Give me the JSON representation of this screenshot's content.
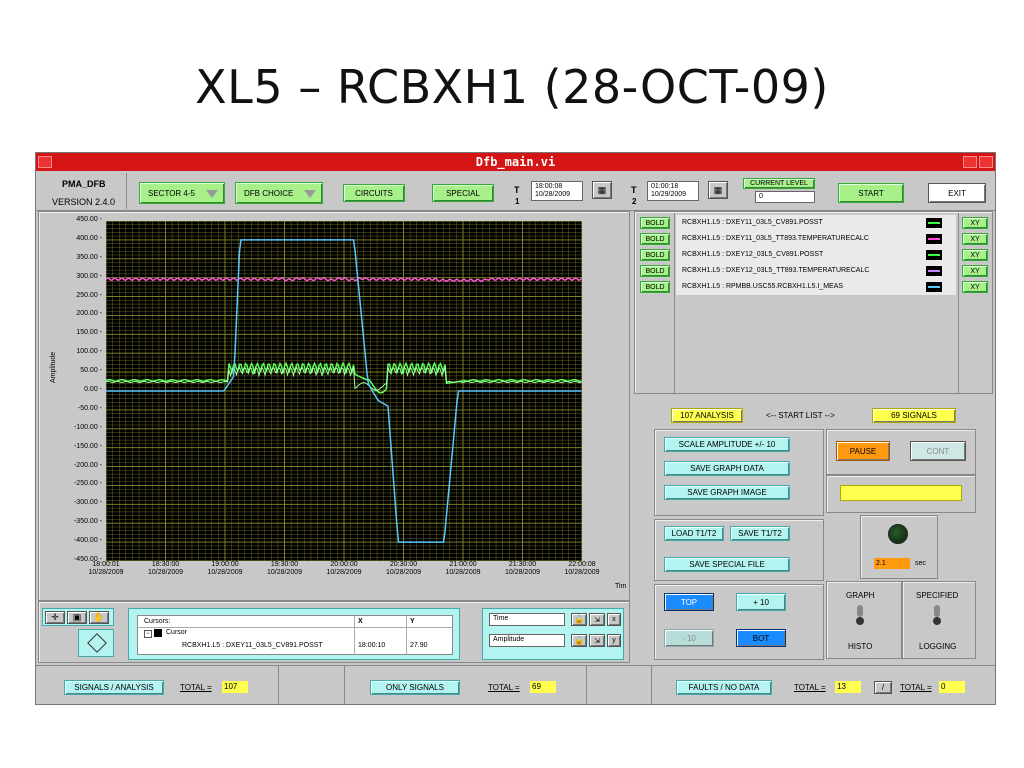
{
  "slide": {
    "title": "XL5 – RCBXH1 (28-OCT-09)"
  },
  "window": {
    "title": "Dfb_main.vi"
  },
  "toolbar": {
    "app_name": "PMA_DFB",
    "version": "VERSION 2.4.0",
    "sector": "SECTOR 4-5",
    "dfb_choice": "DFB CHOICE",
    "circuits": "CIRCUITS",
    "special": "SPECIAL",
    "t1_label": "T",
    "t1_sub": "1",
    "t1_time": "18:00:08",
    "t1_date": "10/28/2009",
    "t2_label": "T",
    "t2_sub": "2",
    "t2_time": "01:00:18",
    "t2_date": "10/29/2009",
    "current_level_label": "CURRENT LEVEL",
    "current_level_value": "0",
    "start": "START",
    "exit": "EXIT"
  },
  "graph": {
    "ylabel": "Amplitude",
    "time_label": "Tim",
    "y_ticks": [
      "450.00",
      "400.00",
      "350.00",
      "300.00",
      "250.00",
      "200.00",
      "150.00",
      "100.00",
      "50.00",
      "0.00",
      "-50.00",
      "-100.00",
      "-150.00",
      "-200.00",
      "-250.00",
      "-300.00",
      "-350.00",
      "-400.00",
      "-450.00"
    ],
    "x_ticks": [
      {
        "time": "18:00:01",
        "date": "10/28/2009"
      },
      {
        "time": "18:30:00",
        "date": "10/28/2009"
      },
      {
        "time": "19:00:00",
        "date": "10/28/2009"
      },
      {
        "time": "19:30:00",
        "date": "10/28/2009"
      },
      {
        "time": "20:00:00",
        "date": "10/28/2009"
      },
      {
        "time": "20:30:00",
        "date": "10/28/2009"
      },
      {
        "time": "21:00:00",
        "date": "10/28/2009"
      },
      {
        "time": "21:30:00",
        "date": "10/28/2009"
      },
      {
        "time": "22:00:08",
        "date": "10/28/2009"
      }
    ],
    "colors": {
      "bg": "#000000",
      "grid": "#8c8c2a",
      "blue": "#5ac8ff",
      "pink": "#ff5ad2",
      "green": "#5aff5a",
      "lightgreen": "#a0ffa0"
    }
  },
  "signals": [
    {
      "bold": "BOLD",
      "name": "RCBXH1.L5 : DXEY11_03L5_CV891.POSST",
      "color": "#3cff3c",
      "xy": "XY"
    },
    {
      "bold": "BOLD",
      "name": "RCBXH1.L5 : DXEY11_03L5_TT893.TEMPERATURECALC",
      "color": "#ff4ad8",
      "xy": "XY"
    },
    {
      "bold": "BOLD",
      "name": "RCBXH1.L5 : DXEY12_03L5_CV891.POSST",
      "color": "#3cff3c",
      "xy": "XY"
    },
    {
      "bold": "BOLD",
      "name": "RCBXH1.L5 : DXEY12_03L5_TT893.TEMPERATURECALC",
      "color": "#c080ff",
      "xy": "XY"
    },
    {
      "bold": "BOLD",
      "name": "RCBXH1.L5 : RPMBB.USC55.RCBXH1.L5.I_MEAS",
      "color": "#5ac8ff",
      "xy": "XY"
    }
  ],
  "startlist": {
    "analysis": "107 ANALYSIS",
    "arrow_text": "<-- START LIST -->",
    "signals": "69 SIGNALS"
  },
  "actions": {
    "scale": "SCALE AMPLITUDE +/- 10",
    "save_graph_data": "SAVE GRAPH DATA",
    "save_graph_image": "SAVE GRAPH IMAGE",
    "load_t1t2": "LOAD T1/T2",
    "save_t1t2": "SAVE T1/T2",
    "save_special": "SAVE SPECIAL FILE",
    "top": "TOP",
    "plus10": "+ 10",
    "minus10": "- 10",
    "bot": "BOT",
    "pause": "PAUSE",
    "cont": "CONT",
    "delay_value": "2.1",
    "delay_unit": "sec",
    "graph": "GRAPH",
    "histo": "HISTO",
    "specified": "SPECIFIED",
    "logging": "LOGGING"
  },
  "cursors": {
    "header": "Cursors:",
    "col_x": "X",
    "col_y": "Y",
    "cursor_name": "Cursor",
    "cursor_signal": "RCBXH1.L5 : DXEY11_03L5_CV891.POSST",
    "x_value": "18:00:10",
    "y_value": "27.90"
  },
  "scales": {
    "time": "Time",
    "amplitude": "Amplitude"
  },
  "footer": {
    "signals_analysis": "SIGNALS / ANALYSIS",
    "total1_label": "TOTAL =",
    "total1": "107",
    "only_signals": "ONLY SIGNALS",
    "total2_label": "TOTAL =",
    "total2": "69",
    "faults": "FAULTS / NO DATA",
    "total3_label": "TOTAL =",
    "total3": "13",
    "slash": "/",
    "total4_label": "TOTAL =",
    "total4": "0"
  }
}
